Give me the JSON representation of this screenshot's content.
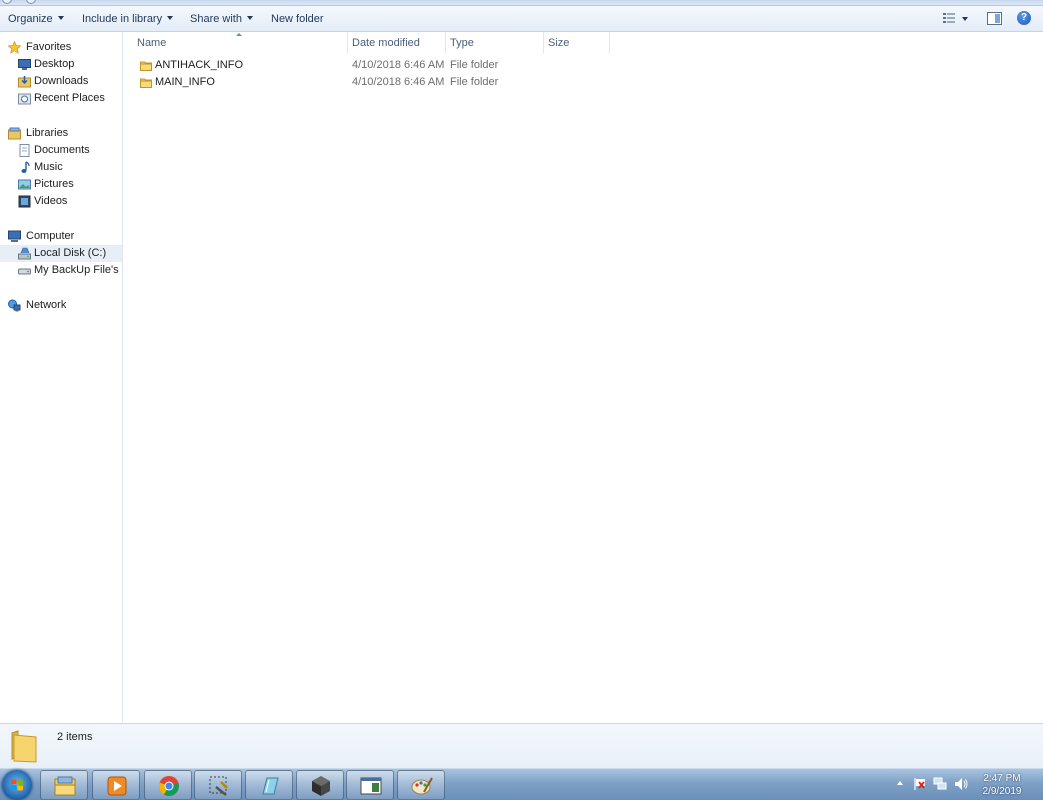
{
  "toolbar": {
    "organize": "Organize",
    "include_in_library": "Include in library",
    "share_with": "Share with",
    "new_folder": "New folder",
    "help": "?"
  },
  "nav": {
    "favorites": {
      "label": "Favorites",
      "items": [
        "Desktop",
        "Downloads",
        "Recent Places"
      ]
    },
    "libraries": {
      "label": "Libraries",
      "items": [
        "Documents",
        "Music",
        "Pictures",
        "Videos"
      ]
    },
    "computer": {
      "label": "Computer",
      "items": [
        "Local Disk (C:)",
        "My BackUp File's (D:"
      ],
      "selected": "Local Disk (C:)"
    },
    "network": {
      "label": "Network"
    }
  },
  "columns": {
    "name": "Name",
    "date_modified": "Date modified",
    "type": "Type",
    "size": "Size"
  },
  "files": [
    {
      "name": "ANTIHACK_INFO",
      "date_modified": "4/10/2018 6:46 AM",
      "type": "File folder",
      "size": ""
    },
    {
      "name": "MAIN_INFO",
      "date_modified": "4/10/2018 6:46 AM",
      "type": "File folder",
      "size": ""
    }
  ],
  "details": {
    "item_count": "2 items"
  },
  "taskbar": {
    "apps": [
      "windows-explorer-icon",
      "media-player-icon",
      "chrome-icon",
      "tools-icon",
      "notepad-icon",
      "virtualbox-icon",
      "window-app-icon",
      "paint-icon"
    ],
    "clock": {
      "time": "2:47 PM",
      "date": "2/9/2019"
    }
  },
  "colors": {
    "accent": "#1e395b",
    "selected": "#e8eef6",
    "taskbar": "#7fa1c6"
  }
}
